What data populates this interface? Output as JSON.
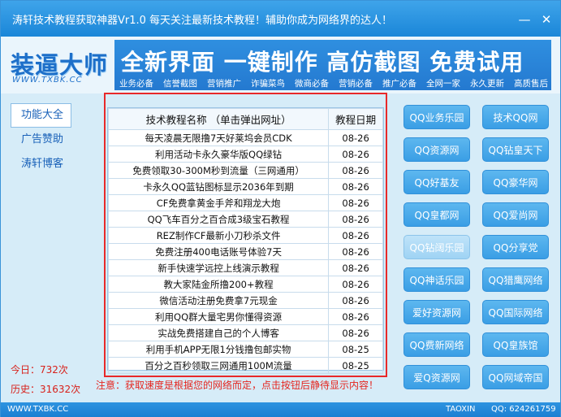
{
  "window": {
    "title": "涛轩技术教程获取神器Vr1.0  每天关注最新技术教程！辅助你成为网络界的达人！",
    "minimize": "—",
    "close": "✕"
  },
  "banner": {
    "logo_text": "装逼大师",
    "logo_url": "WWW.TXBK.CC",
    "slogan": "全新界面  一键制作  高仿截图  免费试用",
    "tags": [
      "业务必备",
      "信誉截图",
      "营销推广",
      "诈骗菜鸟",
      "微商必备",
      "营销必备",
      "推广必备",
      "全网一家",
      "永久更新",
      "高质售后"
    ]
  },
  "sidebar": {
    "items": [
      {
        "label": "功能大全"
      },
      {
        "label": "广告赞助"
      },
      {
        "label": "涛轩博客"
      }
    ],
    "today": "今日：732次",
    "history": "历史：31632次"
  },
  "table": {
    "headers": [
      "技术教程名称  （单击弹出网址）",
      "教程日期"
    ],
    "rows": [
      {
        "name": "每天凌晨无限撸7天好莱坞会员CDK",
        "date": "08-26"
      },
      {
        "name": "利用活动卡永久豪华版QQ绿钻",
        "date": "08-26"
      },
      {
        "name": "免费领取30-300M秒到流量（三网通用）",
        "date": "08-26"
      },
      {
        "name": "卡永久QQ蓝钻图标显示2036年到期",
        "date": "08-26"
      },
      {
        "name": "CF免费拿黄金手斧和翔龙大炮",
        "date": "08-26"
      },
      {
        "name": "QQ飞车百分之百合成3级宝石教程",
        "date": "08-26"
      },
      {
        "name": "REZ制作CF最新小刀秒杀文件",
        "date": "08-26"
      },
      {
        "name": "免费注册400电话账号体验7天",
        "date": "08-26"
      },
      {
        "name": "新手快速学远控上线演示教程",
        "date": "08-26"
      },
      {
        "name": "教大家陆金所撸200+教程",
        "date": "08-26"
      },
      {
        "name": "微信活动注册免费拿7元现金",
        "date": "08-26"
      },
      {
        "name": "利用QQ群大量宅男你懂得资源",
        "date": "08-26"
      },
      {
        "name": "实战免费搭建自己的个人博客",
        "date": "08-26"
      },
      {
        "name": "利用手机APP无限1分钱撸包邮实物",
        "date": "08-25"
      },
      {
        "name": "百分之百秒领取三网通用100M流量",
        "date": "08-25"
      }
    ]
  },
  "notice": "注意：获取速度是根据您的网络而定，点击按钮后静待显示内容！",
  "buttons": {
    "left": [
      "QQ业务乐园",
      "QQ资源网",
      "QQ好基友",
      "QQ皇都网",
      "QQ钻阔乐园",
      "QQ神话乐园",
      "爱好资源网",
      "QQ费新网络",
      "爱Q资源网"
    ],
    "right": [
      "技术QQ网",
      "QQ钻皇天下",
      "QQ豪华网",
      "QQ爱尚网",
      "QQ分享党",
      "QQ猎鹰网络",
      "QQ国际网络",
      "QQ皇族馆",
      "QQ网域帝国"
    ]
  },
  "status": {
    "left": "WWW.TXBK.CC",
    "author": "TAOXIN",
    "qq": "QQ: 624261759"
  },
  "colors": {
    "accent": "#2479d0",
    "notice": "#e5261f",
    "highlight": "#e8292a"
  }
}
